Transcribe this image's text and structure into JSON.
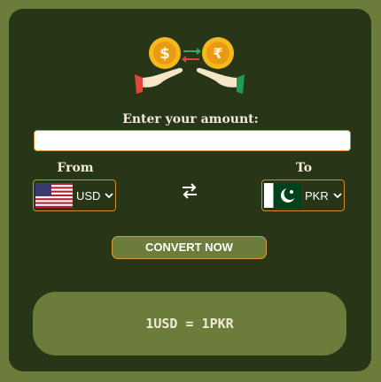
{
  "form": {
    "amount_label": "Enter your amount:",
    "amount_value": "",
    "amount_placeholder": ""
  },
  "from": {
    "label": "From",
    "currency": "USD",
    "flag_icon": "us-flag-icon"
  },
  "to": {
    "label": "To",
    "currency": "PKR",
    "flag_icon": "pk-flag-icon"
  },
  "swap_icon": "swap-arrows-icon",
  "convert_button": {
    "label": "CONVERT NOW"
  },
  "result": {
    "text": "1USD = 1PKR"
  },
  "colors": {
    "page_background": "#6b7c3b",
    "card_background": "#273616",
    "accent_border": "#d78a2e",
    "text_light": "#f1ead5",
    "coin_gold": "#f5b91e"
  }
}
